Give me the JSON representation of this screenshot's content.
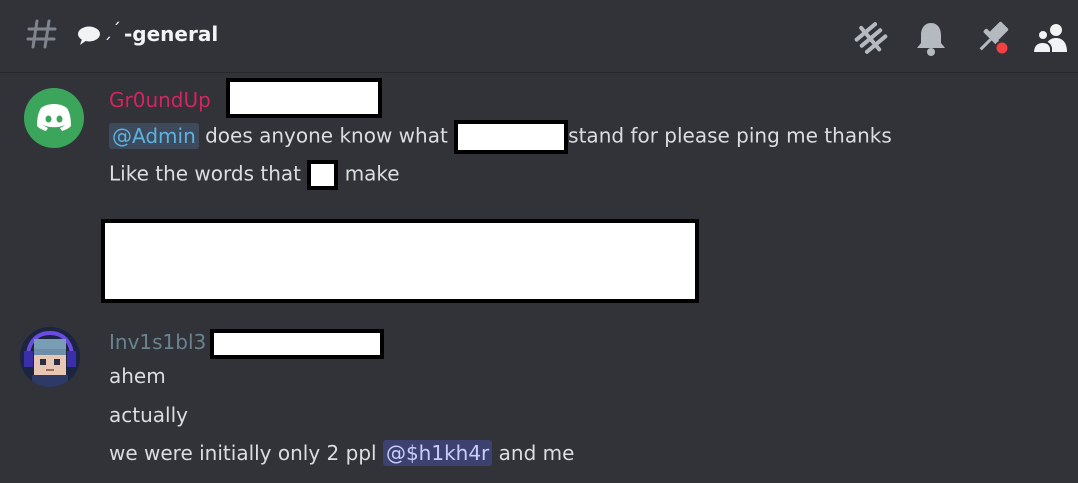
{
  "channel": {
    "name": "-general",
    "deco": "ˏˊ",
    "hash_icon": "hash-icon",
    "bubble_icon": "speech-bubble-icon"
  },
  "header_icons": [
    "threads-icon",
    "bell-icon",
    "pin-icon",
    "members-icon"
  ],
  "messages": [
    {
      "author": "Gr0undUp",
      "author_color": "#d5245f",
      "avatar_icon": "discord-logo-icon",
      "lines": {
        "mention": "@Admin",
        "l1_a": " does anyone know what ",
        "l1_b": "stand for please ping me thanks",
        "l2_a": "Like the words that ",
        "l2_b": "make"
      }
    },
    {
      "author": "Inv1s1bl3",
      "author_color": "#6a8391",
      "avatar_icon": "pixel-character-avatar",
      "lines": {
        "l1": "ahem",
        "l2": "actually",
        "l3_a": "we were initially only 2 ppl ",
        "l3_mention": "@$h1kh4r",
        "l3_b": " and me"
      }
    }
  ]
}
